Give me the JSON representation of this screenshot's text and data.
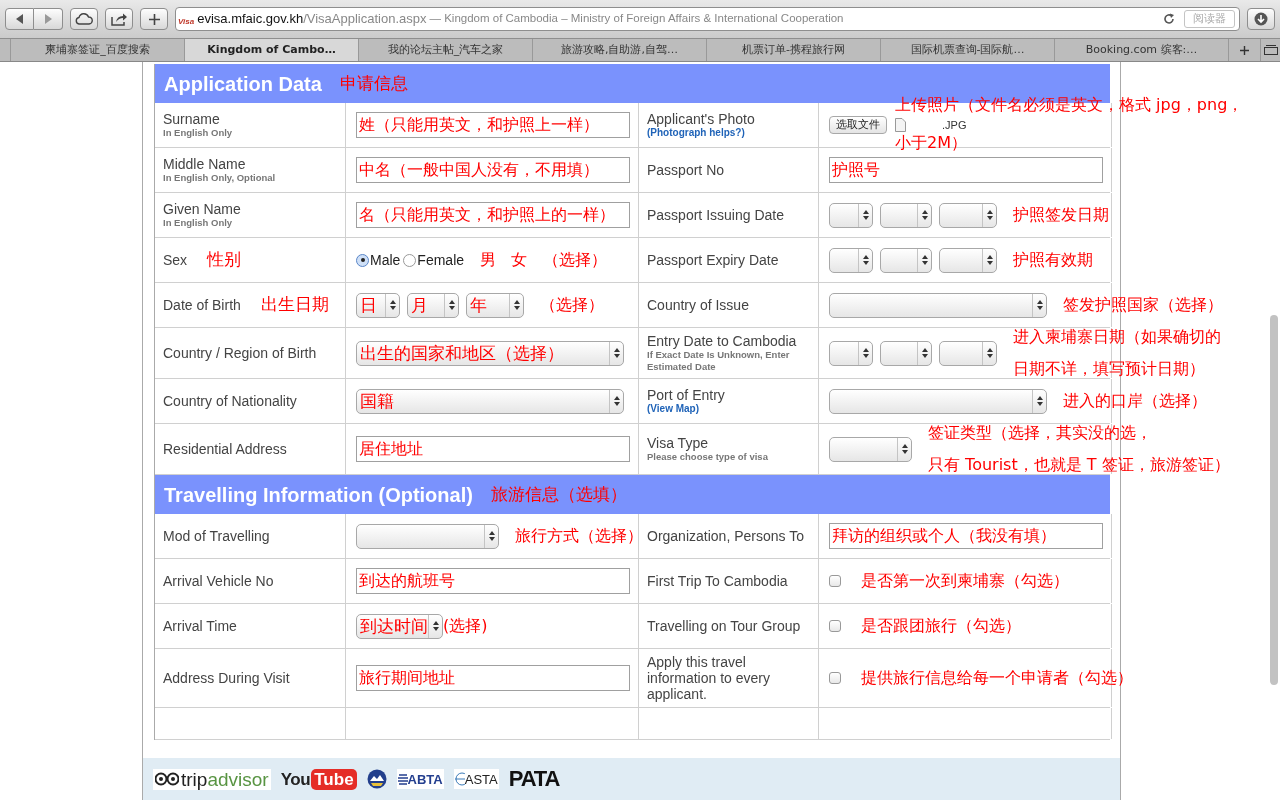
{
  "browser": {
    "url_domain": "evisa.mfaic.gov.kh",
    "url_path": "/VisaApplication.aspx",
    "page_title": "— Kingdom of Cambodia – Ministry of Foreign Affairs & International Cooperation",
    "favicon_text": "Visa",
    "reader": "阅读器",
    "tabs": [
      {
        "label": "柬埔寨签证_百度搜索",
        "selected": false
      },
      {
        "label": "Kingdom of Cambo…",
        "selected": true
      },
      {
        "label": "我的论坛主帖_汽车之家",
        "selected": false
      },
      {
        "label": "旅游攻略,自助游,自驾…",
        "selected": false
      },
      {
        "label": "机票订单-携程旅行网",
        "selected": false
      },
      {
        "label": "国际机票查询-国际航…",
        "selected": false
      },
      {
        "label": "Booking.com 缤客:…",
        "selected": false
      }
    ]
  },
  "sections": [
    {
      "title": "Application Data",
      "note": "申请信息",
      "rows": [
        {
          "cells": [
            {
              "label": "Surname",
              "sub": "In English Only"
            },
            {
              "kind": "text",
              "value": "姓（只能用英文，和护照上一样）"
            },
            {
              "label": "Applicant's Photo",
              "link": "(Photograph helps?)"
            },
            {
              "kind": "file",
              "button": "选取文件",
              "file_name": ".JPG",
              "note": [
                "上传照片（文件名必须是英文，格式 jpg，png，",
                "小于2M）"
              ]
            }
          ]
        },
        {
          "cells": [
            {
              "label": "Middle Name",
              "sub": "In English Only, Optional"
            },
            {
              "kind": "text",
              "value": "中名（一般中国人没有，不用填）"
            },
            {
              "label": "Passport No"
            },
            {
              "kind": "text",
              "value": "护照号"
            }
          ]
        },
        {
          "cells": [
            {
              "label": "Given Name",
              "sub": "In English Only"
            },
            {
              "kind": "text",
              "value": "名（只能用英文，和护照上的一样）"
            },
            {
              "label": "Passport Issuing Date"
            },
            {
              "kind": "date_blank",
              "note": "护照签发日期"
            }
          ]
        },
        {
          "cells": [
            {
              "label": "Sex",
              "note": "性别"
            },
            {
              "kind": "radio",
              "options": [
                {
                  "label": "Male",
                  "selected": true
                },
                {
                  "label": "Female",
                  "selected": false
                }
              ],
              "note": "男   女   （选择）"
            },
            {
              "label": "Passport Expiry Date"
            },
            {
              "kind": "date_blank",
              "note": "护照有效期"
            }
          ]
        },
        {
          "cells": [
            {
              "label": "Date of Birth",
              "note": "出生日期"
            },
            {
              "kind": "date",
              "parts": [
                "日",
                "月",
                "年"
              ],
              "note": "（选择）"
            },
            {
              "label": "Country of Issue"
            },
            {
              "kind": "select",
              "note": "签发护照国家（选择）"
            }
          ]
        },
        {
          "cells": [
            {
              "label": "Country / Region of Birth"
            },
            {
              "kind": "select",
              "value": "出生的国家和地区（选择）"
            },
            {
              "label": "Entry Date to Cambodia",
              "sub": "If Exact Date Is Unknown, Enter Estimated Date"
            },
            {
              "kind": "date_blank",
              "note": [
                "进入柬埔寨日期（如果确切的",
                "日期不详，填写预计日期）"
              ]
            }
          ]
        },
        {
          "cells": [
            {
              "label": "Country of Nationality"
            },
            {
              "kind": "select",
              "value": "国籍"
            },
            {
              "label": "Port of Entry",
              "link": "(View Map)"
            },
            {
              "kind": "select",
              "note": "进入的口岸（选择）"
            }
          ]
        },
        {
          "cells": [
            {
              "label": "Residential Address"
            },
            {
              "kind": "text",
              "value": "居住地址"
            },
            {
              "label": "Visa Type",
              "sub": "Please choose type of visa"
            },
            {
              "kind": "short_select",
              "note": [
                "签证类型（选择，其实没的选，",
                "只有 Tourist，也就是 T 签证，旅游签证）"
              ]
            }
          ]
        }
      ]
    },
    {
      "title": "Travelling Information (Optional)",
      "note": "旅游信息（选填）",
      "rows": [
        {
          "cells": [
            {
              "label": "Mod of Travelling"
            },
            {
              "kind": "short_select",
              "note": "旅行方式（选择）"
            },
            {
              "label": "Organization, Persons To"
            },
            {
              "kind": "text",
              "value": "拜访的组织或个人（我没有填）"
            }
          ]
        },
        {
          "cells": [
            {
              "label": "Arrival Vehicle No"
            },
            {
              "kind": "text",
              "value": "到达的航班号"
            },
            {
              "label": "First Trip To Cambodia"
            },
            {
              "kind": "checkbox",
              "checked": false,
              "note": "是否第一次到柬埔寨（勾选）"
            }
          ]
        },
        {
          "cells": [
            {
              "label": "Arrival Time"
            },
            {
              "kind": "inline_select",
              "value": "到达时间",
              "note": "(选择)"
            },
            {
              "label": "Travelling on Tour Group"
            },
            {
              "kind": "checkbox",
              "checked": false,
              "note": "是否跟团旅行（勾选）"
            }
          ]
        },
        {
          "cells": [
            {
              "label": "Address During Visit"
            },
            {
              "kind": "text",
              "value": "旅行期间地址"
            },
            {
              "label": "Apply this travel information to every applicant."
            },
            {
              "kind": "checkbox",
              "checked": false,
              "note": "提供旅行信息给每一个申请者（勾选）"
            }
          ]
        }
      ]
    }
  ],
  "footer_logos": [
    {
      "kind": "tripadvisor",
      "parts": [
        "trip",
        "advisor"
      ]
    },
    {
      "kind": "youtube",
      "parts": [
        "You",
        "Tube"
      ]
    },
    {
      "kind": "emblem"
    },
    {
      "kind": "abta",
      "parts": [
        "ABTA"
      ]
    },
    {
      "kind": "asta",
      "parts": [
        "ASTA"
      ]
    },
    {
      "kind": "pata",
      "parts": [
        "PATA"
      ]
    }
  ]
}
